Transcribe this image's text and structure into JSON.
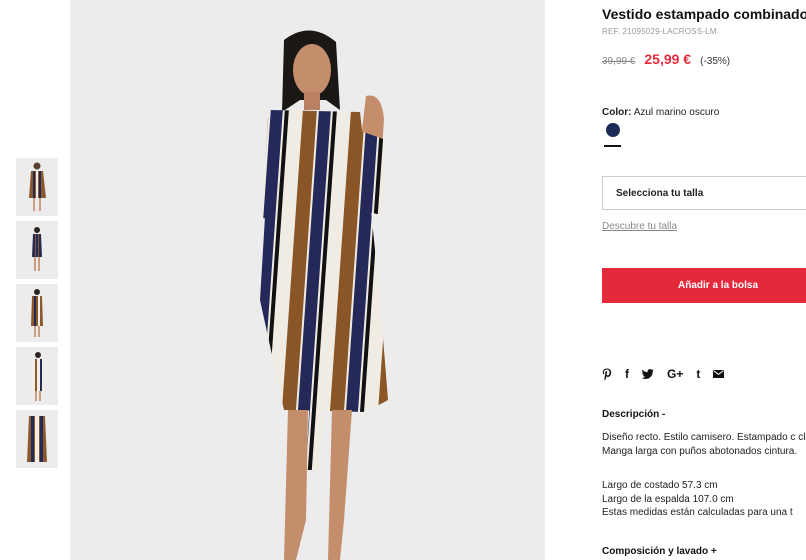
{
  "product": {
    "title": "Vestido estampado combinado",
    "ref": "REF. 21095029-LACROSS-LM",
    "old_price": "39,99 €",
    "new_price": "25,99 €",
    "discount": "(-35%)"
  },
  "color": {
    "label": "Color:",
    "value": "Azul marino oscuro",
    "swatch": "#1c2a57"
  },
  "size": {
    "select_label": "Selecciona tu talla",
    "guide_link": "Descubre tu talla"
  },
  "cart": {
    "add_label": "Añadir a la bolsa",
    "color": "#e4293a"
  },
  "share": {
    "icons": [
      "pinterest-icon",
      "facebook-icon",
      "twitter-icon",
      "google-plus-icon",
      "tumblr-icon",
      "email-icon"
    ],
    "facebook": "f",
    "googleplus": "G+",
    "tumblr": "t"
  },
  "description": {
    "heading": "Descripción -",
    "text": "Diseño recto. Estilo camisero. Estampado c clásico. Manga larga con puños abotonados cintura.",
    "line1": "Largo de costado 57.3 cm",
    "line2": "Largo de la espalda 107.0 cm",
    "line3": "Estas medidas están calculadas para una t"
  },
  "composition": {
    "heading": "Composición y lavado +"
  },
  "gallery": {
    "thumbnail_count": 5
  }
}
